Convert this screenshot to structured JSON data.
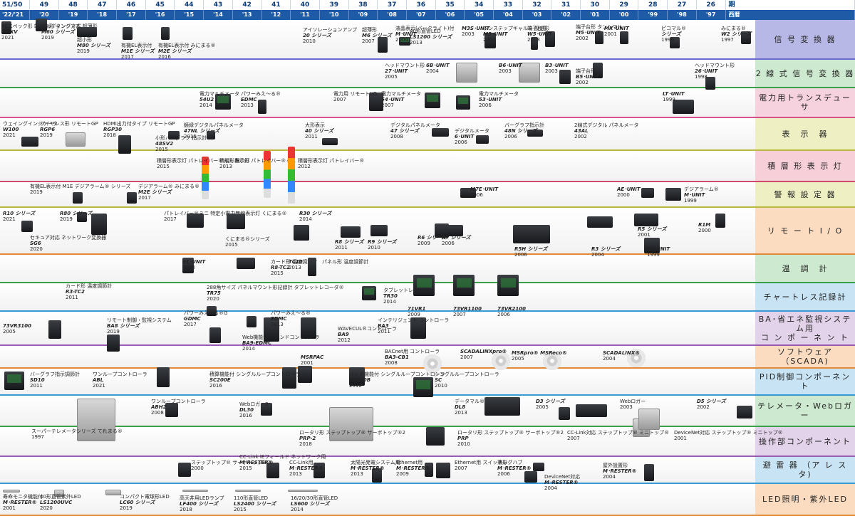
{
  "header": {
    "row1": [
      "51/50",
      "49",
      "48",
      "47",
      "46",
      "45",
      "44",
      "43",
      "42",
      "41",
      "40",
      "39",
      "38",
      "37",
      "36",
      "35",
      "34",
      "33",
      "32",
      "31",
      "30",
      "29",
      "28",
      "27",
      "26",
      "期"
    ],
    "row2": [
      "'22/'21",
      "'20",
      "'19",
      "'18",
      "'17",
      "'16",
      "'15",
      "'14",
      "'13",
      "'12",
      "'11",
      "'10",
      "'09",
      "'08",
      "'07",
      "'06",
      "'05",
      "'04",
      "'03",
      "'02",
      "'01",
      "'00",
      "'99",
      "'98",
      "'97",
      "西暦"
    ]
  },
  "categories": [
    {
      "label": "信 号 変 換 器",
      "color": "#b8b8e6",
      "line": "#6a6ad0"
    },
    {
      "label": "2 線 式 信 号 変 換 器",
      "color": "#cde9cf",
      "line": "#3aa04a"
    },
    {
      "label": "電力用トランスデューサ",
      "color": "#f6d1de",
      "line": "#d8518a"
    },
    {
      "label": "表　示　器",
      "color": "#eef0c4",
      "line": "#b8b840"
    },
    {
      "label": "積 層 形 表 示 灯",
      "color": "#f6cfd9",
      "line": "#d04a70"
    },
    {
      "label": "警 報 設 定 器",
      "color": "#eef0c4",
      "line": "#b8b840"
    },
    {
      "label": "リ モ ー ト I / O",
      "color": "#fbdcc0",
      "line": "#e08a3a"
    },
    {
      "label": "温　調　計",
      "color": "#cde9cf",
      "line": "#3aa04a"
    },
    {
      "label": "チャートレス記録計",
      "color": "#c8e4f4",
      "line": "#3a9ad6"
    },
    {
      "label": "BA･省エネ監視システム用\nコ ン ポ ー ネ ン ト",
      "color": "#e3d3ea",
      "line": "#9a5ab4"
    },
    {
      "label": "ソフトウェア（SCADA)",
      "color": "#fbdcc0",
      "line": "#e08a3a"
    },
    {
      "label": "PID制御コンポーネント",
      "color": "#c8e4f4",
      "line": "#3a9ad6"
    },
    {
      "label": "テレメータ・Webロガー",
      "color": "#cde9cf",
      "line": "#3aa04a"
    },
    {
      "label": "操作部コンポーネント",
      "color": "#e3d3ea",
      "line": "#9a5ab4"
    },
    {
      "label": "避 雷 器 （ア レ ス タ)",
      "color": "#c8e4f4",
      "line": "#3a9ad6"
    },
    {
      "label": "LED照明・紫外LED",
      "color": "#fbdcc0",
      "line": "#e08a3a"
    }
  ],
  "products": [
    {
      "name": "PCスペック形 端子台形 タンシマル",
      "code": "M5XV",
      "year": "2021"
    },
    {
      "name": "ビルディング方式 超薄形",
      "code": "M60 シリーズ",
      "year": "2019"
    },
    {
      "name": "超小形",
      "code": "M80 シリーズ",
      "year": "2019"
    },
    {
      "name": "有機EL表示付",
      "code": "M1E シリーズ",
      "year": "2017"
    },
    {
      "name": "有機EL表示付 みにまる®",
      "code": "M2E シリーズ",
      "year": "2016"
    },
    {
      "name": "アイソレーションアンプ",
      "code": "20 シリーズ",
      "year": "2010"
    },
    {
      "name": "超薄形",
      "code": "M6 シリーズ",
      "year": "2007"
    },
    {
      "name": "液晶表示(バックライト)付",
      "code": "M･UNIT",
      "year": "2004"
    },
    {
      "name": "",
      "code": "M3S･UNIT",
      "year": "2003"
    },
    {
      "name": "ワンステップキャル® 設定形",
      "code": "M3･UNIT",
      "year": "2003"
    },
    {
      "name": "端子台形",
      "code": "W5･UNIT",
      "year": "2003"
    },
    {
      "name": "端子台形 タンシマル",
      "code": "M5･UNIT",
      "year": "2002"
    },
    {
      "name": "",
      "code": "MX･UNIT",
      "year": "2001"
    },
    {
      "name": "ピコマル®",
      "code": "シリーズ",
      "year": "1999"
    },
    {
      "name": "みにまる®",
      "code": "W2 シリーズ",
      "year": "1997"
    },
    {
      "name": "ヘッドマウント形",
      "code": "27･UNIT",
      "year": "2005"
    },
    {
      "name": "",
      "code": "6B･UNIT",
      "year": "2004"
    },
    {
      "name": "",
      "code": "B6･UNIT",
      "year": "2003"
    },
    {
      "name": "",
      "code": "B3･UNIT",
      "year": "2003"
    },
    {
      "name": "端子台形",
      "code": "B5･UNIT",
      "year": "2002"
    },
    {
      "name": "ヘッドマウント形",
      "code": "26･UNIT",
      "year": "1998"
    },
    {
      "name": "電力マルチメータ",
      "code": "54U2",
      "year": "2014"
    },
    {
      "name": "パワーみえ～る®",
      "code": "EDMC",
      "year": "2013"
    },
    {
      "name": "電力用 リモートI/O",
      "code": "",
      "year": "2007"
    },
    {
      "name": "電力マルチメータ",
      "code": "54･UNIT",
      "year": "2007"
    },
    {
      "name": "電力マルチメータ",
      "code": "53･UNIT",
      "year": "2006"
    },
    {
      "name": "",
      "code": "LT･UNIT",
      "year": "1999"
    },
    {
      "name": "ウェイングインジケータ",
      "code": "W100",
      "year": "2021"
    },
    {
      "name": "ワイヤレス形 リモートGP",
      "code": "RGP6",
      "year": "2019"
    },
    {
      "name": "HDMI出力付タイプ リモートGP",
      "code": "RGP30",
      "year": "2018"
    },
    {
      "name": "小形バーグラフ 指示計",
      "code": "48SV2",
      "year": "2015"
    },
    {
      "name": "鏡緑デジタルパネルメータ",
      "code": "47NL シリーズ",
      "year": "2015"
    },
    {
      "name": "大形表示",
      "code": "40 シリーズ",
      "year": "2011"
    },
    {
      "name": "デジタルパネルメータ",
      "code": "47 シリーズ",
      "year": "2008"
    },
    {
      "name": "デジタルメータ",
      "code": "6･UNIT",
      "year": "2006"
    },
    {
      "name": "バーグラフ指示計",
      "code": "48N シリーズ",
      "year": "2006"
    },
    {
      "name": "2線式デジタル パネルメータ",
      "code": "43AL",
      "year": "2002"
    },
    {
      "name": "積層形表示灯 パトレイバー®ミニ 超小形",
      "code": "",
      "year": "2015"
    },
    {
      "name": "積層形表示灯 パトレイバー®ミニ",
      "code": "",
      "year": "2013"
    },
    {
      "name": "積層形表示灯 パトレイバー®",
      "code": "",
      "year": "2012"
    },
    {
      "name": "有機EL表示付 M1E デジアラーム® シリーズ",
      "code": "",
      "year": "2019"
    },
    {
      "name": "デジアラーム® みにまる®",
      "code": "M2E シリーズ",
      "year": "2017"
    },
    {
      "name": "",
      "code": "M7E･UNIT",
      "year": "2006"
    },
    {
      "name": "",
      "code": "AE･UNIT",
      "year": "2000"
    },
    {
      "name": "デジアラーム®",
      "code": "M･UNIT",
      "year": "1999"
    },
    {
      "name": "",
      "code": "R10 シリーズ",
      "year": "2021"
    },
    {
      "name": "",
      "code": "R80 シリーズ",
      "year": "2019"
    },
    {
      "name": "セキュア対応 ネットワーク変換器",
      "code": "SG6",
      "year": "2020"
    },
    {
      "name": "パトレイバー®ミニ 特定小電力無線表示灯 くにまる®",
      "code": "",
      "year": "2017"
    },
    {
      "name": "くにまる®シリーズ",
      "code": "",
      "year": "2015"
    },
    {
      "name": "",
      "code": "R30 シリーズ",
      "year": "2014"
    },
    {
      "name": "",
      "code": "R8 シリーズ",
      "year": "2011"
    },
    {
      "name": "",
      "code": "R9 シリーズ",
      "year": "2010"
    },
    {
      "name": "",
      "code": "R6 シリーズ",
      "year": "2009"
    },
    {
      "name": "",
      "code": "R7 シリーズ",
      "year": "2006"
    },
    {
      "name": "",
      "code": "R5H シリーズ",
      "year": "2006"
    },
    {
      "name": "",
      "code": "R3 シリーズ",
      "year": "2004"
    },
    {
      "name": "",
      "code": "R5 シリーズ",
      "year": "2001"
    },
    {
      "name": "",
      "code": "R1M",
      "year": "2000"
    },
    {
      "name": "",
      "code": "60･UNIT",
      "year": "1999"
    },
    {
      "name": "",
      "code": "61･UNIT",
      "year": "2000"
    },
    {
      "name": "カード形 温度調節計",
      "code": "R8-TC2",
      "year": "2015"
    },
    {
      "name": "",
      "code": "TC10",
      "year": "2013"
    },
    {
      "name": "パネル形 温度調節計",
      "code": "",
      "year": ""
    },
    {
      "name": "カード形 温度調節計",
      "code": "R3-TC2",
      "year": "2011"
    },
    {
      "name": "288角サイズ パネルマウント形記録計 タブレットレコーダ®",
      "code": "TR75",
      "year": "2020"
    },
    {
      "name": "タブレットレコーダ®",
      "code": "TR30",
      "year": "2014"
    },
    {
      "name": "",
      "code": "71VR1",
      "year": "2009"
    },
    {
      "name": "",
      "code": "73VR1100",
      "year": "2007"
    },
    {
      "name": "",
      "code": "73VR2100",
      "year": "2006"
    },
    {
      "name": "",
      "code": "73VR3100",
      "year": "2005"
    },
    {
      "name": "リモート制御・監視システム",
      "code": "BA8 シリーズ",
      "year": "2019"
    },
    {
      "name": "パワーみえ～る®G",
      "code": "GDMC",
      "year": "2017"
    },
    {
      "name": "Web機能付 デマンドコントローラ",
      "code": "BA9-EDMC",
      "year": "2014"
    },
    {
      "name": "パワーみえ～る®",
      "code": "EDMC",
      "year": "2013"
    },
    {
      "name": "WAVECUL®コントローラ",
      "code": "BA9",
      "year": "2012"
    },
    {
      "name": "インテリジェント コントローラ",
      "code": "BA3",
      "year": "2011"
    },
    {
      "name": "BACnet用 コントローラ",
      "code": "BA3-CB1",
      "year": "2008"
    },
    {
      "name": "",
      "code": "SCADALINXpro®",
      "year": "2007"
    },
    {
      "name": "",
      "code": "MSRpro® MSReco®",
      "year": "2005"
    },
    {
      "name": "",
      "code": "SCADALINX®",
      "year": "2004"
    },
    {
      "name": "",
      "code": "MSRPAC",
      "year": "2001"
    },
    {
      "name": "バーグラフ指示調節計",
      "code": "SD10",
      "year": "2011"
    },
    {
      "name": "ワンループコントローラ",
      "code": "ABL",
      "year": "2021"
    },
    {
      "name": "積算機能付 シングルループコントローラ",
      "code": "SC200E",
      "year": "2016"
    },
    {
      "name": "バッチ機能付 シングルループコントローラ",
      "code": "SC200B",
      "year": "2012"
    },
    {
      "name": "シングルループコントローラ",
      "code": "SC",
      "year": "2010"
    },
    {
      "name": "ワンループコントローラ",
      "code": "ABH2",
      "year": "2008"
    },
    {
      "name": "Webロガー2",
      "code": "DL30",
      "year": "2016"
    },
    {
      "name": "データマル®",
      "code": "DL8",
      "year": "2013"
    },
    {
      "name": "",
      "code": "D3 シリーズ",
      "year": "2005"
    },
    {
      "name": "Webロガー",
      "code": "",
      "year": "2003"
    },
    {
      "name": "",
      "code": "D5 シリーズ",
      "year": "2002"
    },
    {
      "name": "スーパーテレメータシリーズ てれまる®",
      "code": "",
      "year": "1997"
    },
    {
      "name": "ロータリ形 ステップトップ® サーボトップ®2",
      "code": "PRP-2",
      "year": "2018"
    },
    {
      "name": "ロータリ形 ステップトップ® サーボトップ®2",
      "code": "PRP",
      "year": "2010"
    },
    {
      "name": "CC-Link対応 ステップトップ® ミニトップ®",
      "code": "",
      "year": "2007"
    },
    {
      "name": "DeviceNet対応 ステップトップ® ミニトップ®",
      "code": "",
      "year": "2001"
    },
    {
      "name": "ステップトップ® サーボトップ®2",
      "code": "",
      "year": "2000"
    },
    {
      "name": "CC-Link IEフィールド ネットワーク用",
      "code": "M･RESTER®",
      "year": "2015"
    },
    {
      "name": "CC-Link用",
      "code": "M･RESTER®",
      "year": "2013"
    },
    {
      "name": "太陽光発電システム用",
      "code": "M･RESTER®",
      "year": "2013"
    },
    {
      "name": "Ethernet用",
      "code": "M･RESTER®",
      "year": "2009"
    },
    {
      "name": "Ethernet用 スイッチングハブ",
      "code": "",
      "year": "2007"
    },
    {
      "name": "薄形",
      "code": "M･RESTER®",
      "year": "2006"
    },
    {
      "name": "DeviceNet対応",
      "code": "M･RESTER®",
      "year": "2004"
    },
    {
      "name": "屋外設置形",
      "code": "M･RESTER®",
      "year": "2004"
    },
    {
      "name": "寿命モニタ機能付",
      "code": "M･RESTER®",
      "year": "2001"
    },
    {
      "name": "40形直管紫外LED",
      "code": "LS1200UVC",
      "year": "2020"
    },
    {
      "name": "コンパクト電球形LED",
      "code": "LC60 シリーズ",
      "year": "2019"
    },
    {
      "name": "高天井用LEDランプ",
      "code": "LF400 シリーズ",
      "year": "2018"
    },
    {
      "name": "110形直管LED",
      "code": "LS2400 シリーズ",
      "year": "2015"
    },
    {
      "name": "16/20/30形直管LED",
      "code": "LS600 シリーズ",
      "year": "2014"
    },
    {
      "name": "40形直管LED",
      "code": "LS1200 シリーズ",
      "year": "2013"
    }
  ]
}
